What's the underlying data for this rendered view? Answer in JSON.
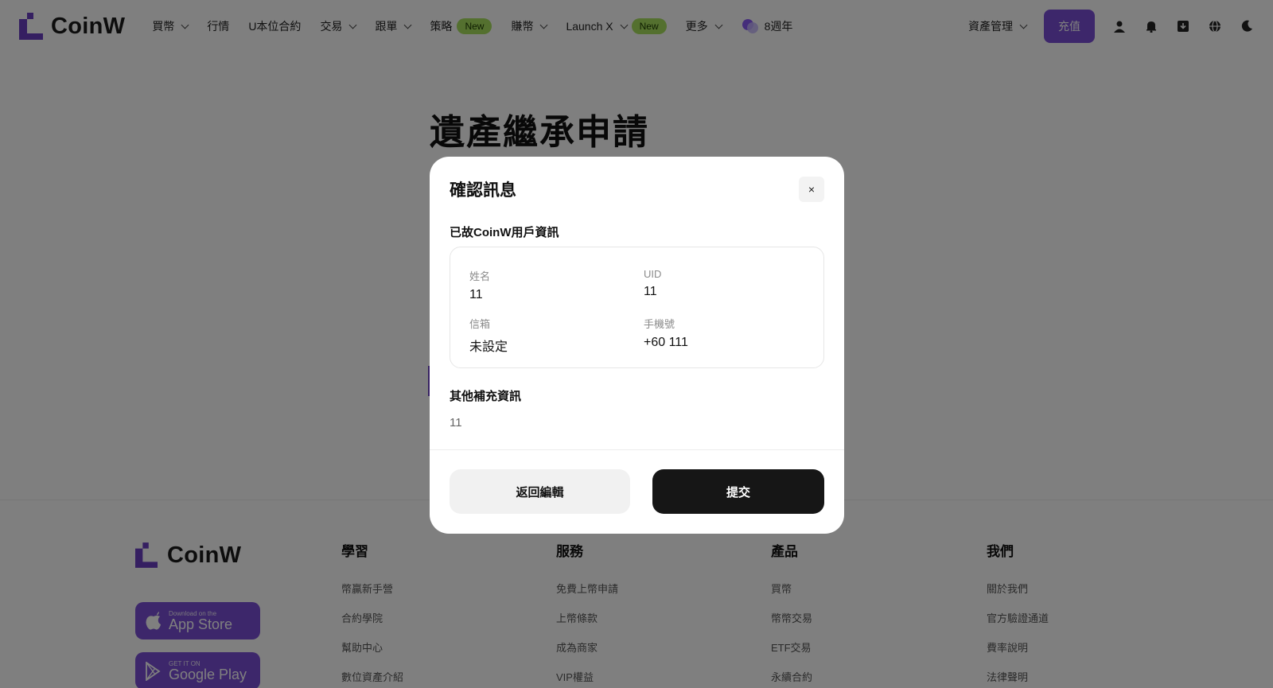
{
  "brand": {
    "name": "CoinW",
    "color": "#7b4fd6"
  },
  "header": {
    "nav": [
      {
        "label": "買幣",
        "dropdown": true
      },
      {
        "label": "行情",
        "dropdown": false
      },
      {
        "label": "U本位合約",
        "dropdown": false
      },
      {
        "label": "交易",
        "dropdown": true
      },
      {
        "label": "跟單",
        "dropdown": true
      },
      {
        "label": "策略",
        "badge": "New"
      },
      {
        "label": "賺幣",
        "dropdown": true
      },
      {
        "label": "Launch X",
        "dropdown": true,
        "badge": "New"
      },
      {
        "label": "更多",
        "dropdown": true
      }
    ],
    "anniversary": "8週年",
    "asset_mgmt": "資產管理",
    "deposit": "充值",
    "icons": [
      "user-icon",
      "bell-icon",
      "download-icon",
      "globe-icon",
      "moon-icon"
    ]
  },
  "page": {
    "title": "遺產繼承申請"
  },
  "modal": {
    "title": "確認訊息",
    "close": "×",
    "user_section": "已故CoinW用戶資訊",
    "fields": {
      "name_label": "姓名",
      "name_value": "11",
      "uid_label": "UID",
      "uid_value": "11",
      "email_label": "信箱",
      "email_value": "未設定",
      "phone_label": "手機號",
      "phone_value": "+60 111"
    },
    "extra_section": "其他補充資訊",
    "extra_value": "11",
    "back_button": "返回編輯",
    "submit_button": "提交"
  },
  "footer": {
    "app_store": {
      "small": "Download on the",
      "big": "App Store"
    },
    "google_play": {
      "small": "GET IT ON",
      "big": "Google Play"
    },
    "columns": [
      {
        "title": "學習",
        "links": [
          "幣贏新手營",
          "合約學院",
          "幫助中心",
          "數位資產介紹"
        ]
      },
      {
        "title": "服務",
        "links": [
          "免費上幣申請",
          "上幣條款",
          "成為商家",
          "VIP權益"
        ]
      },
      {
        "title": "產品",
        "links": [
          "買幣",
          "幣幣交易",
          "ETF交易",
          "永續合約"
        ]
      },
      {
        "title": "我們",
        "links": [
          "關於我們",
          "官方驗證通道",
          "費率說明",
          "法律聲明"
        ]
      }
    ]
  }
}
